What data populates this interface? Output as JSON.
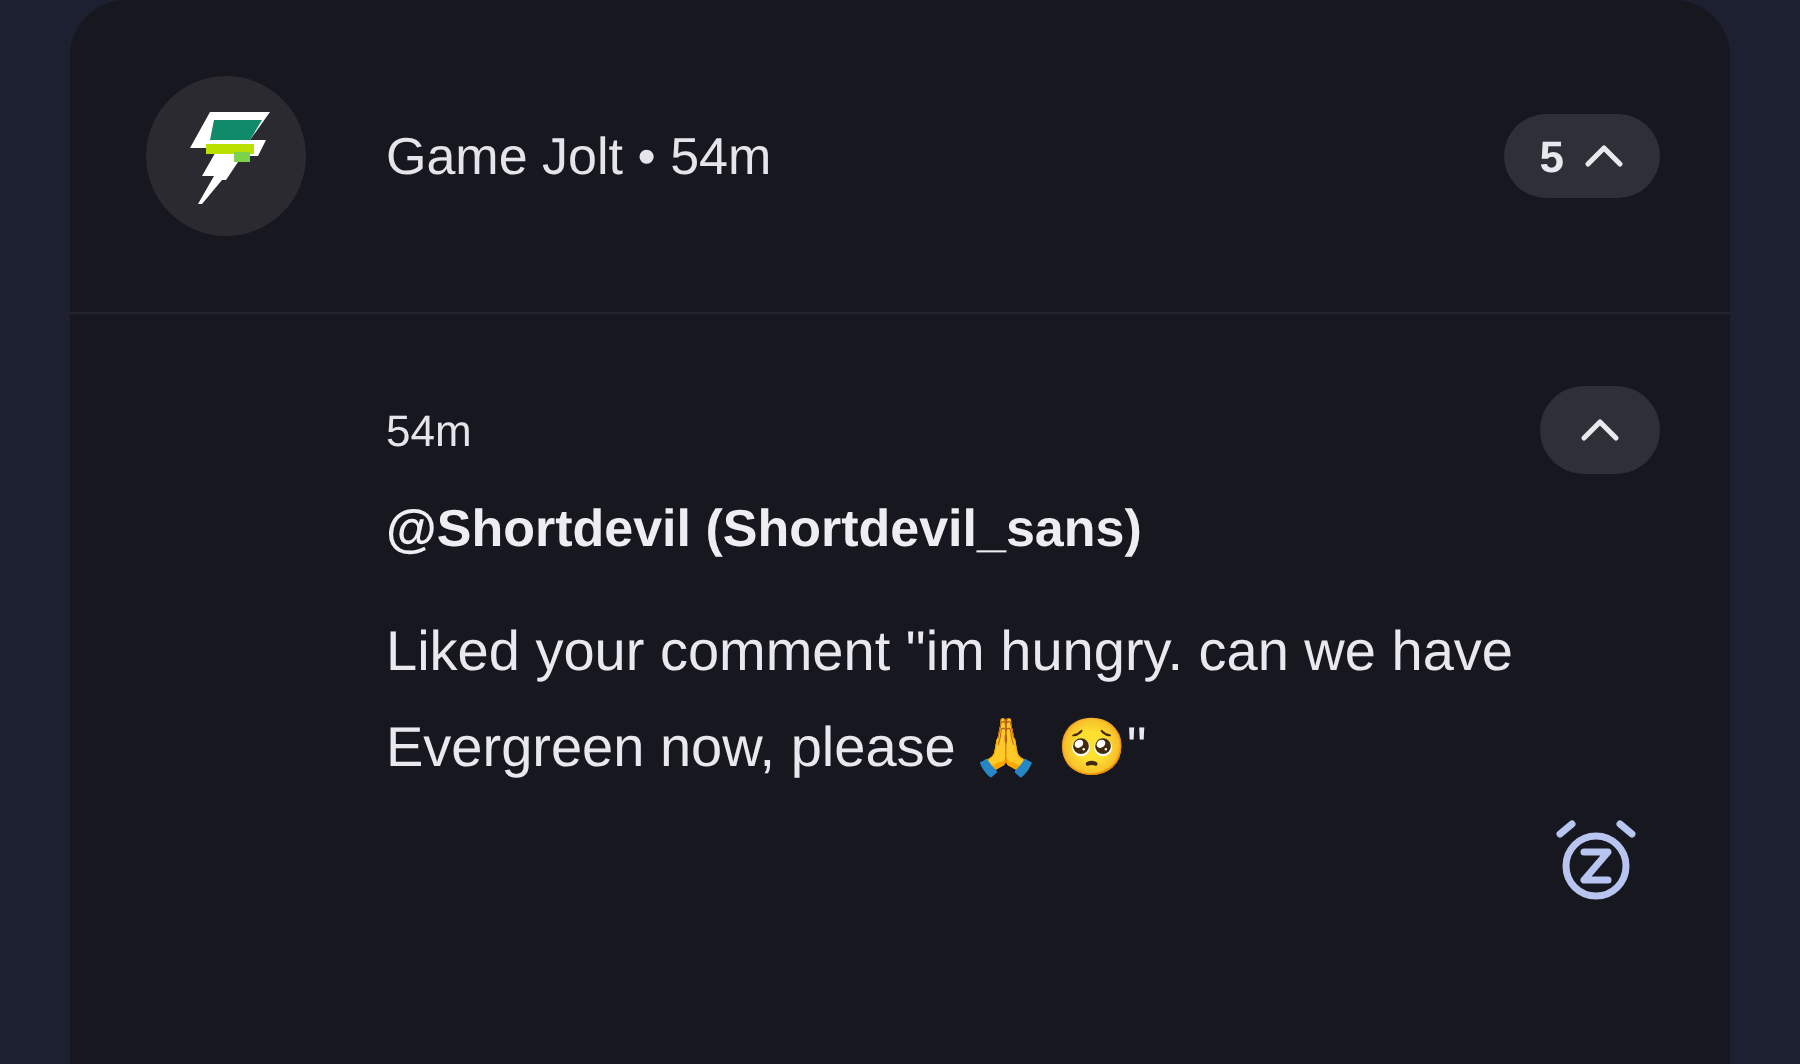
{
  "notification": {
    "app_name": "Game Jolt",
    "separator": "•",
    "time": "54m",
    "count": "5",
    "expanded": true
  },
  "message": {
    "time": "54m",
    "sender": "@Shortdevil (Shortdevil_sans)",
    "body": "Liked your comment \"im hungry. can we have Evergreen now, please 🙏 🥺\"",
    "expanded": true
  }
}
